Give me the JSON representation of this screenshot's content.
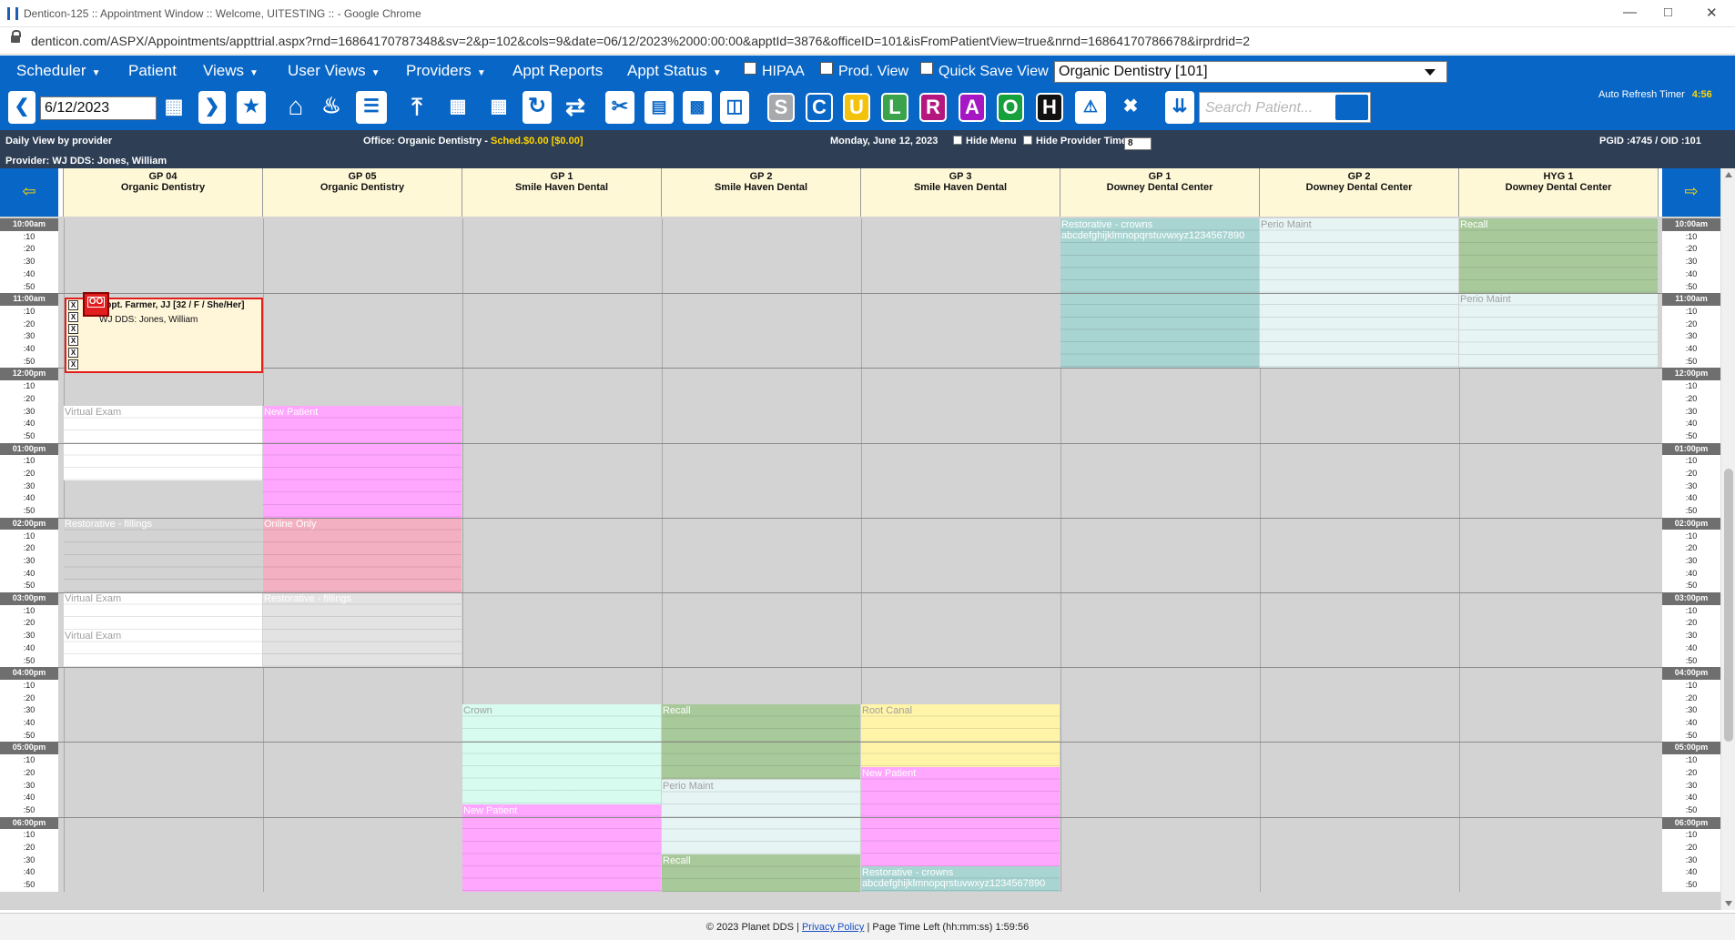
{
  "window": {
    "title": "Denticon-125 :: Appointment Window :: Welcome, UITESTING :: - Google Chrome",
    "url": "denticon.com/ASPX/Appointments/appttrial.aspx?rnd=16864170787348&sv=2&p=102&cols=9&date=06/12/2023%2000:00:00&apptId=3876&officeID=101&isFromPatientView=true&nrnd=16864170786678&irprdrid=2"
  },
  "menu": {
    "scheduler": "Scheduler",
    "patient": "Patient",
    "views": "Views",
    "user_views": "User Views",
    "providers": "Providers",
    "appt_reports": "Appt Reports",
    "appt_status": "Appt Status",
    "hipaa": "HIPAA",
    "prod_view": "Prod. View",
    "quick_save_view": "Quick Save View",
    "office_selected": "Organic Dentistry [101]"
  },
  "toolbar": {
    "date": "6/12/2023",
    "letters": [
      "S",
      "C",
      "U",
      "L",
      "R",
      "A",
      "O",
      "H"
    ],
    "letter_colors": [
      "#a7a9ac",
      "#0a67c6",
      "#f2c20d",
      "#3aa34c",
      "#b5177f",
      "#a517c3",
      "#17a13c",
      "#111111"
    ],
    "search_placeholder": "Search Patient...",
    "auto_refresh_label": "Auto Refresh Timer",
    "auto_refresh_value": "4:56"
  },
  "info": {
    "daily_view": "Daily View by provider",
    "office_label": "Office: Organic Dentistry -",
    "sched": "Sched.$0.00 [$0.00]",
    "date_text": "Monday, June 12, 2023",
    "hide_menu": "Hide Menu",
    "hide_provider_time": "Hide Provider Time",
    "interval": "8",
    "pgid": "PGID :4745  /  OID :101",
    "provider": "Provider: WJ DDS: Jones, William"
  },
  "columns": [
    {
      "name": "GP 04",
      "office": "Organic Dentistry"
    },
    {
      "name": "GP 05",
      "office": "Organic Dentistry"
    },
    {
      "name": "GP 1",
      "office": "Smile Haven Dental"
    },
    {
      "name": "GP 2",
      "office": "Smile Haven Dental"
    },
    {
      "name": "GP 3",
      "office": "Smile Haven Dental"
    },
    {
      "name": "GP 1",
      "office": "Downey Dental Center"
    },
    {
      "name": "GP 2",
      "office": "Downey Dental Center"
    },
    {
      "name": "HYG 1",
      "office": "Downey Dental Center"
    }
  ],
  "times": [
    "10:00am",
    ":10",
    ":20",
    ":30",
    ":40",
    ":50",
    "11:00am",
    ":10",
    ":20",
    ":30",
    ":40",
    ":50",
    "12:00pm",
    ":10",
    ":20",
    ":30",
    ":40",
    ":50",
    "01:00pm",
    ":10",
    ":20",
    ":30",
    ":40",
    ":50",
    "02:00pm",
    ":10",
    ":20",
    ":30",
    ":40",
    ":50",
    "03:00pm",
    ":10",
    ":20",
    ":30",
    ":40",
    ":50",
    "04:00pm",
    ":10",
    ":20",
    ":30",
    ":40",
    ":50",
    "05:00pm",
    ":10",
    ":20",
    ":30",
    ":40",
    ":50",
    "06:00pm",
    ":10",
    ":20",
    ":30",
    ":40",
    ":50"
  ],
  "blocks": [
    {
      "col": 5,
      "start": 0,
      "rows": 12,
      "label": "Restorative - crowns",
      "sub": "abcdefghijklmnopqrstuvwxyz1234567890",
      "color": "#a8d4d2",
      "text": "white"
    },
    {
      "col": 6,
      "start": 0,
      "rows": 12,
      "label": "Perio Maint",
      "color": "#e6f4f4",
      "text": "dim"
    },
    {
      "col": 7,
      "start": 0,
      "rows": 6,
      "label": "Recall",
      "color": "#a8c99a",
      "text": "white"
    },
    {
      "col": 7,
      "start": 6,
      "rows": 6,
      "label": "Perio Maint",
      "color": "#e6f4f4",
      "text": "dim"
    },
    {
      "col": 0,
      "start": 15,
      "rows": 6,
      "label": "Virtual Exam",
      "color": "#ffffff",
      "text": "dim"
    },
    {
      "col": 1,
      "start": 15,
      "rows": 9,
      "label": "New Patient",
      "color": "#ffa6ff",
      "text": "white"
    },
    {
      "col": 0,
      "start": 24,
      "rows": 6,
      "label": "Restorative - fillings",
      "color": "#d3d3d3",
      "text": "white"
    },
    {
      "col": 1,
      "start": 24,
      "rows": 6,
      "label": "Online Only",
      "color": "#f2b0c2",
      "text": "white"
    },
    {
      "col": 0,
      "start": 30,
      "rows": 3,
      "label": "Virtual Exam",
      "color": "#ffffff",
      "text": "dim"
    },
    {
      "col": 0,
      "start": 33,
      "rows": 3,
      "label": "Virtual Exam",
      "color": "#ffffff",
      "text": "dim"
    },
    {
      "col": 1,
      "start": 30,
      "rows": 6,
      "label": "Restorative - fillings",
      "color": "#e3e3e3",
      "text": "white"
    },
    {
      "col": 2,
      "start": 39,
      "rows": 8,
      "label": "Crown",
      "color": "#d7fbef",
      "text": "dim"
    },
    {
      "col": 3,
      "start": 39,
      "rows": 6,
      "label": "Recall",
      "color": "#a8c99a",
      "text": "white"
    },
    {
      "col": 4,
      "start": 39,
      "rows": 5,
      "label": "Root Canal",
      "color": "#fff4a8",
      "text": "dim"
    },
    {
      "col": 3,
      "start": 45,
      "rows": 6,
      "label": "Perio Maint",
      "color": "#e6f4f4",
      "text": "dim"
    },
    {
      "col": 4,
      "start": 44,
      "rows": 8,
      "label": "New Patient",
      "color": "#ffa6ff",
      "text": "white"
    },
    {
      "col": 2,
      "start": 47,
      "rows": 7,
      "label": "New Patient",
      "color": "#ffa6ff",
      "text": "white"
    },
    {
      "col": 3,
      "start": 51,
      "rows": 3,
      "label": "Recall",
      "color": "#a8c99a",
      "text": "white"
    },
    {
      "col": 4,
      "start": 52,
      "rows": 2,
      "label": "Restorative - crowns",
      "sub": "abcdefghijklmnopqrstuvwxyz1234567890",
      "color": "#a8d4d2",
      "text": "white"
    }
  ],
  "appointment": {
    "line1": "Appt. Farmer, JJ [32 / F / She/Her]",
    "line2": "WJ DDS: Jones, William",
    "code": "OO"
  },
  "footer": {
    "copyright": "© 2023 Planet DDS |",
    "privacy": "Privacy Policy",
    "sep": "|",
    "time_left": "Page Time Left (hh:mm:ss) 1:59:56"
  }
}
